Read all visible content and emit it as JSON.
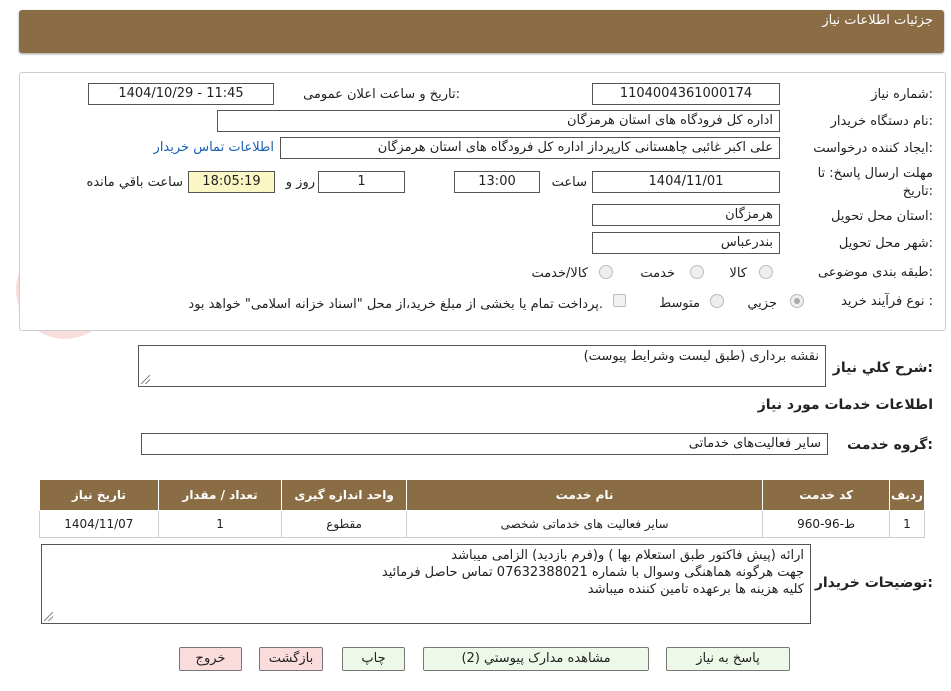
{
  "header": {
    "title": "جزئیات اطلاعات نیاز"
  },
  "form": {
    "need_number": {
      "label": "شماره نیاز:",
      "value": "1104004361000174"
    },
    "announce": {
      "label": "تاریخ و ساعت اعلان عمومی:",
      "value": "1404/10/29 - 11:45"
    },
    "buyer_org": {
      "label": "نام دستگاه خریدار:",
      "value": "اداره کل فرودگاه های استان هرمزگان"
    },
    "requester": {
      "label": "ایجاد کننده درخواست:",
      "value": "علی اکبر غائبی چاهستانی کارپرداز اداره کل فرودگاه های استان هرمزگان"
    },
    "contact_link": "اطلاعات تماس خریدار",
    "deadline": {
      "label_line1": "مهلت ارسال پاسخ: تا",
      "label_line2": "تاریخ:",
      "date": "1404/11/01",
      "time_label": "ساعت",
      "time": "13:00",
      "days": "1",
      "days_label": "روز و",
      "remaining": "18:05:19",
      "remaining_label": "ساعت باقي مانده"
    },
    "province": {
      "label": "استان محل تحویل:",
      "value": "هرمزگان"
    },
    "city": {
      "label": "شهر محل تحویل:",
      "value": "بندرعباس"
    },
    "category": {
      "label": "طبقه بندی موضوعی:",
      "options": [
        "کالا",
        "خدمت",
        "کالا/خدمت"
      ],
      "selected": "خدمت"
    },
    "process": {
      "label": "نوع فرآیند خرید :",
      "options": [
        "جزیي",
        "متوسط"
      ],
      "selected": "جزیي",
      "note": "پرداخت تمام یا بخشی از مبلغ خرید،از محل \"اسناد خزانه اسلامی\" خواهد بود."
    }
  },
  "summary": {
    "label": "شرح کلي نیاز:",
    "value": "نقشه برداری (طبق لیست وشرایط پیوست)"
  },
  "services_title": "اطلاعات خدمات مورد نیاز",
  "service_group": {
    "label": "گروه خدمت:",
    "value": "سایر فعالیت‌های خدماتی"
  },
  "table": {
    "headers": [
      "ردیف",
      "کد خدمت",
      "نام خدمت",
      "واحد اندازه گیری",
      "تعداد / مقدار",
      "تاریخ نیاز"
    ],
    "rows": [
      [
        "1",
        "ط-96-960",
        "سایر فعالیت های خدماتی شخصی",
        "مقطوع",
        "1",
        "1404/11/07"
      ]
    ]
  },
  "buyer_notes": {
    "label": "توضیحات خریدار:",
    "lines": [
      "ارائه (پیش فاکتور طبق استعلام بها ) و(فرم بازدید)   الزامی میباشد",
      "جهت هرگونه هماهنگی وسوال با شماره 07632388021 تماس حاصل فرمائید",
      "کلیه هزینه ها برعهده تامین کننده میباشد"
    ]
  },
  "buttons": {
    "reply": "پاسخ به نیاز",
    "attachments": "مشاهده مدارک پیوستي (2)",
    "print": "چاپ",
    "back": "بازگشت",
    "exit": "خروج"
  },
  "colors": {
    "header": "#8a6d45",
    "button_green": "#eef8e8",
    "button_red": "#fbdcdc",
    "link": "#1a5fb4"
  }
}
